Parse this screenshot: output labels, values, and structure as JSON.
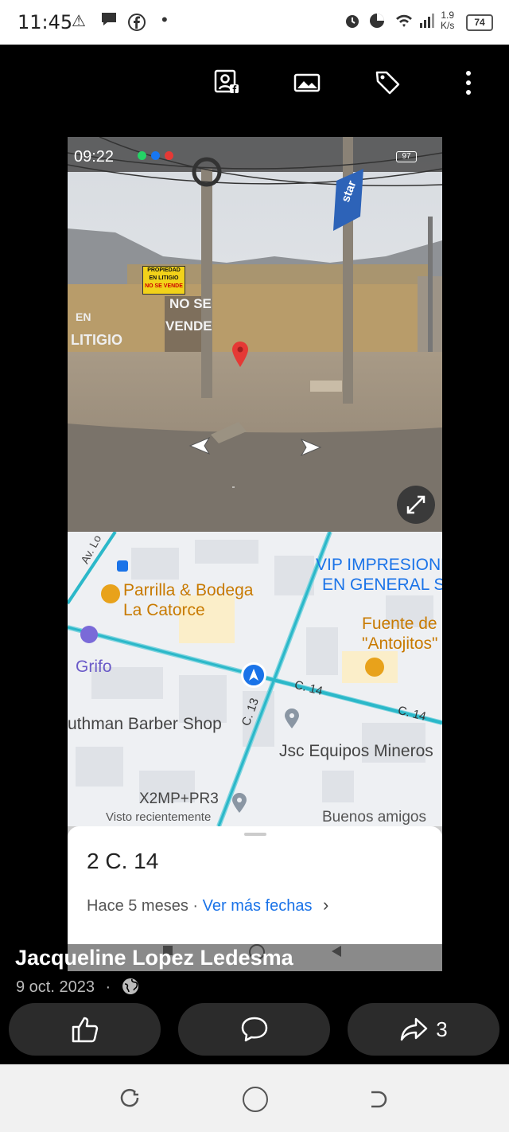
{
  "status_bar": {
    "time": "11:45",
    "net_speed_value": "1.9",
    "net_speed_unit": "K/s",
    "battery": "74"
  },
  "toolbar": {
    "icons": [
      "profile-photo-icon",
      "image-icon",
      "tag-icon",
      "more-icon"
    ]
  },
  "photo": {
    "inner_status": {
      "time": "09:22",
      "battery": "97"
    },
    "street_view": {
      "sign_text": [
        "PROPIEDAD",
        "EN LITIGIO",
        "NO SE VENDE"
      ],
      "wall_text_1": "NO SE",
      "wall_text_2": "VENDE",
      "wall_text_3": "EN",
      "wall_text_4": "LITIGIO",
      "pole_sign": "star"
    },
    "map": {
      "street_av": "Av. Lo",
      "place_parrilla_1": "Parrilla & Bodega",
      "place_parrilla_2": "La Catorce",
      "place_grifo": "Grifo",
      "place_vip_1": "VIP IMPRESIONE",
      "place_vip_2": "EN GENERAL S",
      "place_fuente_1": "Fuente de",
      "place_fuente_2": "\"Antojitos\"",
      "street_c14_a": "C. 14",
      "street_c14_b": "C. 14",
      "street_c13": "C. 13",
      "place_barber": "uthman Barber Shop",
      "place_jsc": "Jsc Equipos Mineros",
      "place_plus": "X2MP+PR3",
      "place_visto": "Visto recientemente",
      "place_buenos": "Buenos amigos"
    },
    "sheet": {
      "address": "2 C. 14",
      "age": "Hace 5 meses",
      "sep": " · ",
      "more_dates": "Ver más fechas",
      "chevron": "›"
    }
  },
  "post": {
    "author": "Jacqueline Lopez Ledesma",
    "date": "9 oct. 2023",
    "dot": "·",
    "share_count": "3"
  },
  "colors": {
    "map_road": "#2bb8c9",
    "map_poi_orange": "#e8a21b",
    "map_label_blue": "#1a73e8",
    "link_blue": "#1a73e8"
  }
}
